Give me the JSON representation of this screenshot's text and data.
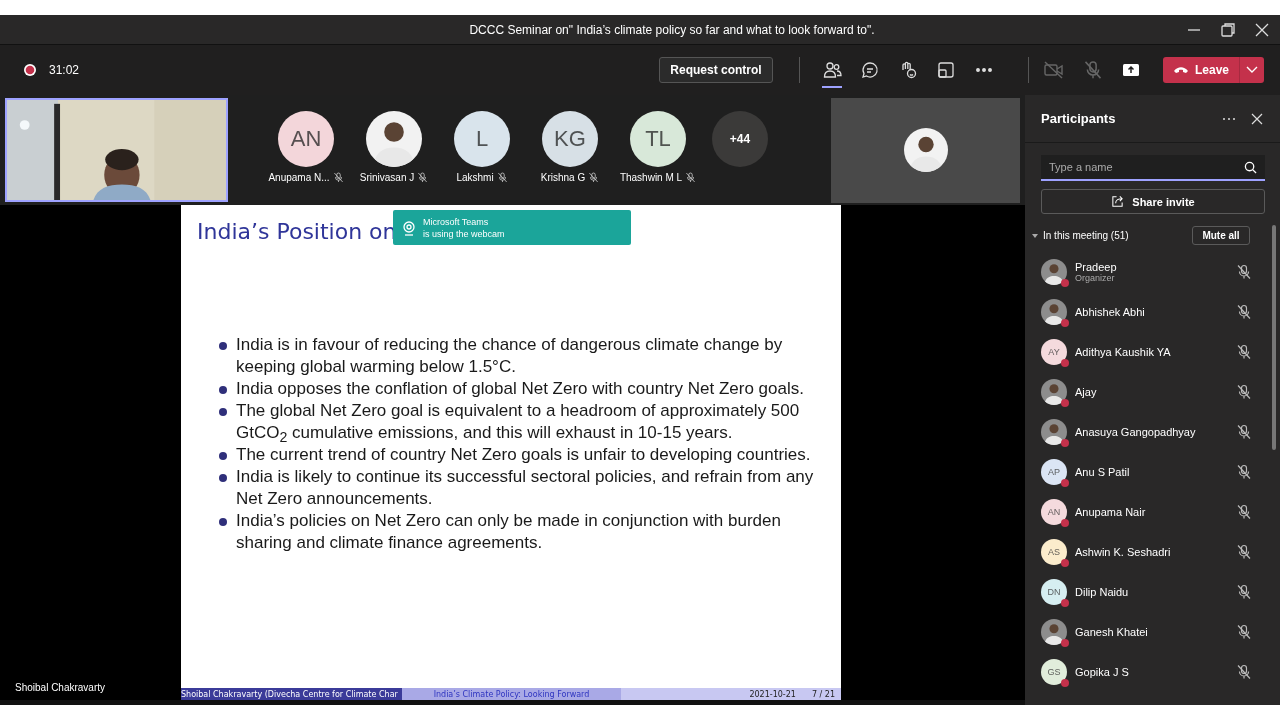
{
  "window": {
    "title": "DCCC Seminar on\" India’s climate policy so far and what to look forward to\"."
  },
  "toolbar": {
    "recording": true,
    "timer": "31:02",
    "request_control": "Request control",
    "tools": [
      {
        "kind": "people",
        "selected": true
      },
      {
        "kind": "chat",
        "selected": false
      },
      {
        "kind": "react",
        "selected": false
      },
      {
        "kind": "rooms",
        "selected": false
      },
      {
        "kind": "more",
        "selected": false
      }
    ],
    "camera_on": false,
    "mic_on": false,
    "leave": "Leave"
  },
  "video_strip": {
    "participants": [
      {
        "kind": "initials",
        "initials": "AN",
        "name": "Anupama N...",
        "muted": true,
        "color": "#f3d6da"
      },
      {
        "name": "Srinivasan J",
        "muted": true
      },
      {
        "kind": "initials",
        "initials": "L",
        "name": "Lakshmi",
        "muted": true,
        "color": "#d9e4ec"
      },
      {
        "kind": "initials",
        "initials": "KG",
        "name": "Krishna G",
        "muted": true,
        "color": "#d7e0e6"
      },
      {
        "kind": "initials",
        "initials": "TL",
        "name": "Thashwin M L",
        "muted": true,
        "color": "#d8e8d9"
      }
    ],
    "overflow": "+44"
  },
  "stage": {
    "presenter": "Shoibal Chakravarty",
    "slide": {
      "title": "India’s Position on",
      "bullets": [
        "India is in favour of reducing the chance of dangerous climate change by keeping global warming below 1.5°C.",
        "India opposes the conflation of global Net Zero with country Net Zero goals.",
        "The global Net Zero goal is equivalent to a headroom of approximately 500 GtCO$_{2}$ cumulative emissions, and this will exhaust in 10-15 years.",
        "The current trend of country Net Zero goals is unfair to developing countries.",
        "India is likely to continue its successful sectoral policies, and refrain from any Net Zero announcements.",
        "India’s policies on Net Zero can only be made in conjunction with burden sharing and climate finance agreements."
      ],
      "footer": {
        "author": "Shoibal Chakravarty (Divecha Centre for Climate Char",
        "title": "India’s Climate Policy: Looking Forward",
        "date": "2021-10-21",
        "page": "7 / 21"
      }
    },
    "toast": {
      "app": "Microsoft Teams",
      "message": "is using the webcam"
    }
  },
  "panel": {
    "title": "Participants",
    "search": {
      "placeholder": "Type a name"
    },
    "share_invite": "Share invite",
    "section": {
      "label": "In this meeting (51)",
      "expanded": true,
      "mute_all": "Mute all"
    },
    "people": [
      {
        "name": "Pradeep",
        "role": "Organizer",
        "busy": true,
        "muted": true
      },
      {
        "name": "Abhishek Abhi",
        "busy": true,
        "muted": true
      },
      {
        "kind": "initials",
        "initials": "AY",
        "color": "#f4dadd",
        "name": "Adithya Kaushik YA",
        "busy": true,
        "muted": true
      },
      {
        "name": "Ajay",
        "busy": true,
        "muted": true
      },
      {
        "name": "Anasuya Gangopadhyay",
        "busy": true,
        "muted": true
      },
      {
        "kind": "initials",
        "initials": "AP",
        "color": "#dbe5f4",
        "name": "Anu S Patil",
        "busy": true,
        "muted": true
      },
      {
        "kind": "initials",
        "initials": "AN",
        "color": "#f4dadd",
        "name": "Anupama Nair",
        "busy": true,
        "muted": true
      },
      {
        "kind": "initials",
        "initials": "AS",
        "color": "#fbeccc",
        "name": "Ashwin K. Seshadri",
        "busy": true,
        "muted": true
      },
      {
        "kind": "initials",
        "initials": "DN",
        "color": "#d6eef1",
        "name": "Dilip Naidu",
        "busy": true,
        "muted": true
      },
      {
        "name": "Ganesh Khatei",
        "busy": true,
        "muted": true
      },
      {
        "kind": "initials",
        "initials": "GS",
        "color": "#e1eddb",
        "name": "Gopika J S",
        "busy": true,
        "muted": true
      }
    ]
  }
}
